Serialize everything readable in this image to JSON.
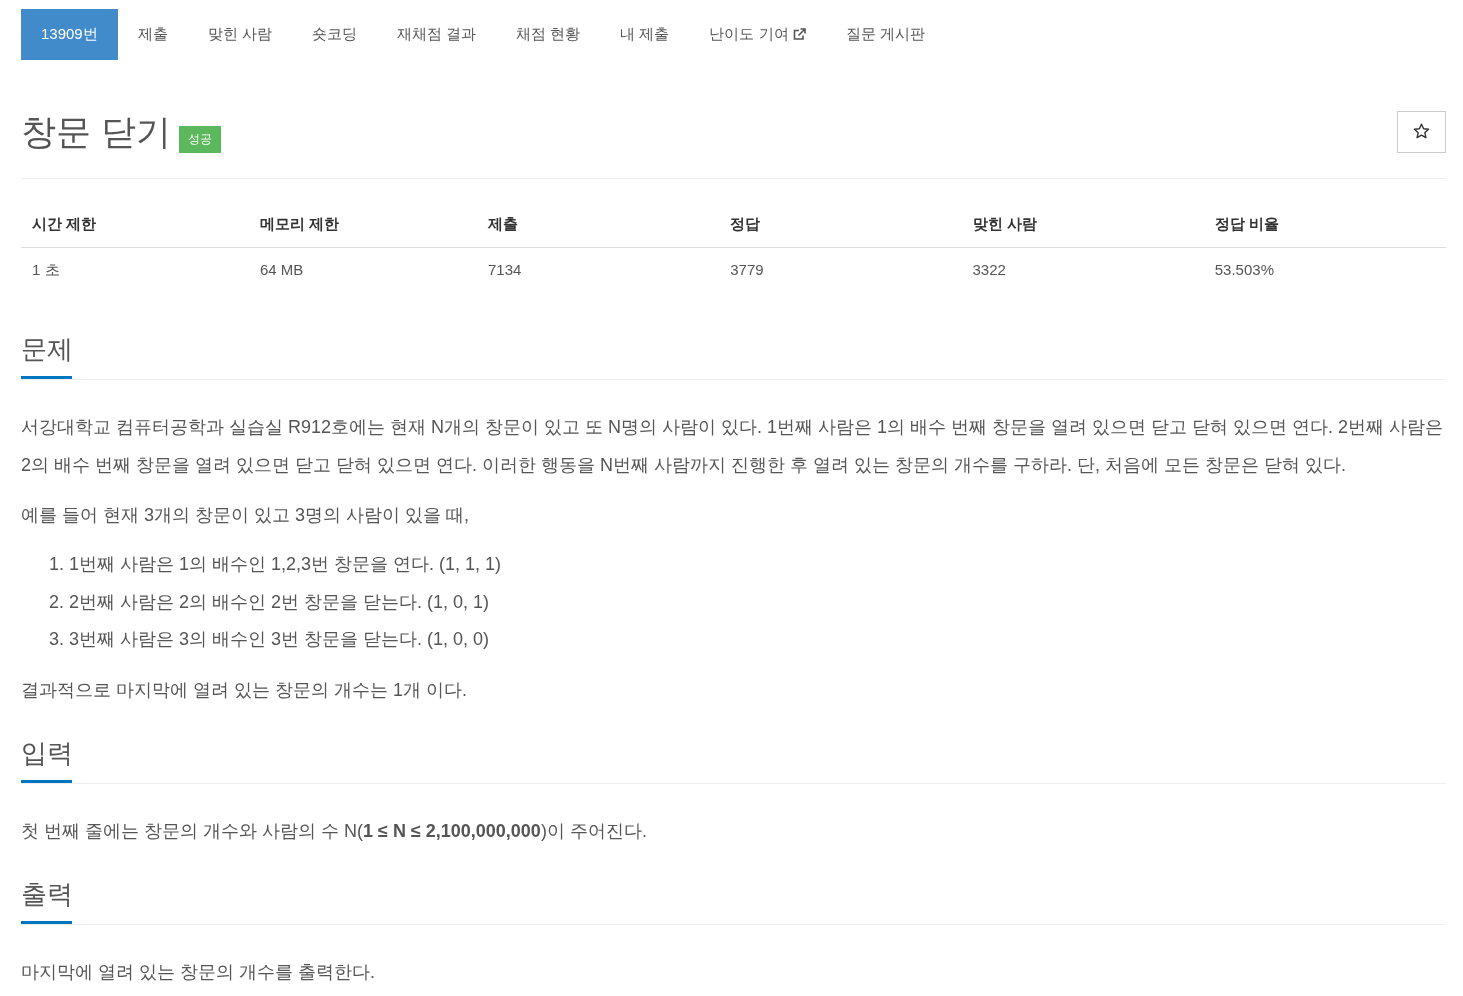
{
  "tabs": [
    {
      "label": "13909번",
      "selected": true,
      "external": false
    },
    {
      "label": "제출",
      "selected": false,
      "external": false
    },
    {
      "label": "맞힌 사람",
      "selected": false,
      "external": false
    },
    {
      "label": "숏코딩",
      "selected": false,
      "external": false
    },
    {
      "label": "재채점 결과",
      "selected": false,
      "external": false
    },
    {
      "label": "채점 현황",
      "selected": false,
      "external": false
    },
    {
      "label": "내 제출",
      "selected": false,
      "external": false
    },
    {
      "label": "난이도 기여",
      "selected": false,
      "external": true
    },
    {
      "label": "질문 게시판",
      "selected": false,
      "external": false
    }
  ],
  "problem": {
    "title": "창문 닫기",
    "badge": "성공"
  },
  "info_table": {
    "columns": [
      "시간 제한",
      "메모리 제한",
      "제출",
      "정답",
      "맞힌 사람",
      "정답 비율"
    ],
    "rows": [
      [
        "1 초",
        "64 MB",
        "7134",
        "3779",
        "3322",
        "53.503%"
      ]
    ]
  },
  "sections": [
    {
      "heading": "문제",
      "blocks": [
        {
          "kind": "paragraph",
          "text": "서강대학교 컴퓨터공학과 실습실 R912호에는 현재 N개의 창문이 있고 또 N명의 사람이 있다. 1번째 사람은 1의 배수 번째 창문을 열려 있으면 닫고 닫혀 있으면 연다. 2번째 사람은 2의 배수 번째 창문을 열려 있으면 닫고 닫혀 있으면 연다. 이러한 행동을 N번째 사람까지 진행한 후 열려 있는 창문의 개수를 구하라. 단, 처음에 모든 창문은 닫혀 있다."
        },
        {
          "kind": "paragraph",
          "text": "예를 들어 현재 3개의 창문이 있고 3명의 사람이 있을 때,"
        },
        {
          "kind": "list",
          "items": [
            "1. 1번째 사람은 1의 배수인 1,2,3번 창문을 연다. (1, 1, 1)",
            "2. 2번째 사람은 2의 배수인 2번 창문을 닫는다. (1, 0, 1)",
            "3. 3번째 사람은 3의 배수인 3번 창문을 닫는다. (1, 0, 0)"
          ]
        },
        {
          "kind": "paragraph",
          "text": "결과적으로 마지막에 열려 있는 창문의 개수는 1개 이다."
        }
      ]
    },
    {
      "heading": "입력",
      "blocks": [
        {
          "kind": "paragraph",
          "text": "첫 번째 줄에는 창문의 개수와 사람의 수 N(**1 ≤ N ≤ 2,100,000,000**)이 주어진다."
        }
      ]
    },
    {
      "heading": "출력",
      "blocks": [
        {
          "kind": "paragraph",
          "text": "마지막에 열려 있는 창문의 개수를 출력한다."
        }
      ]
    }
  ]
}
